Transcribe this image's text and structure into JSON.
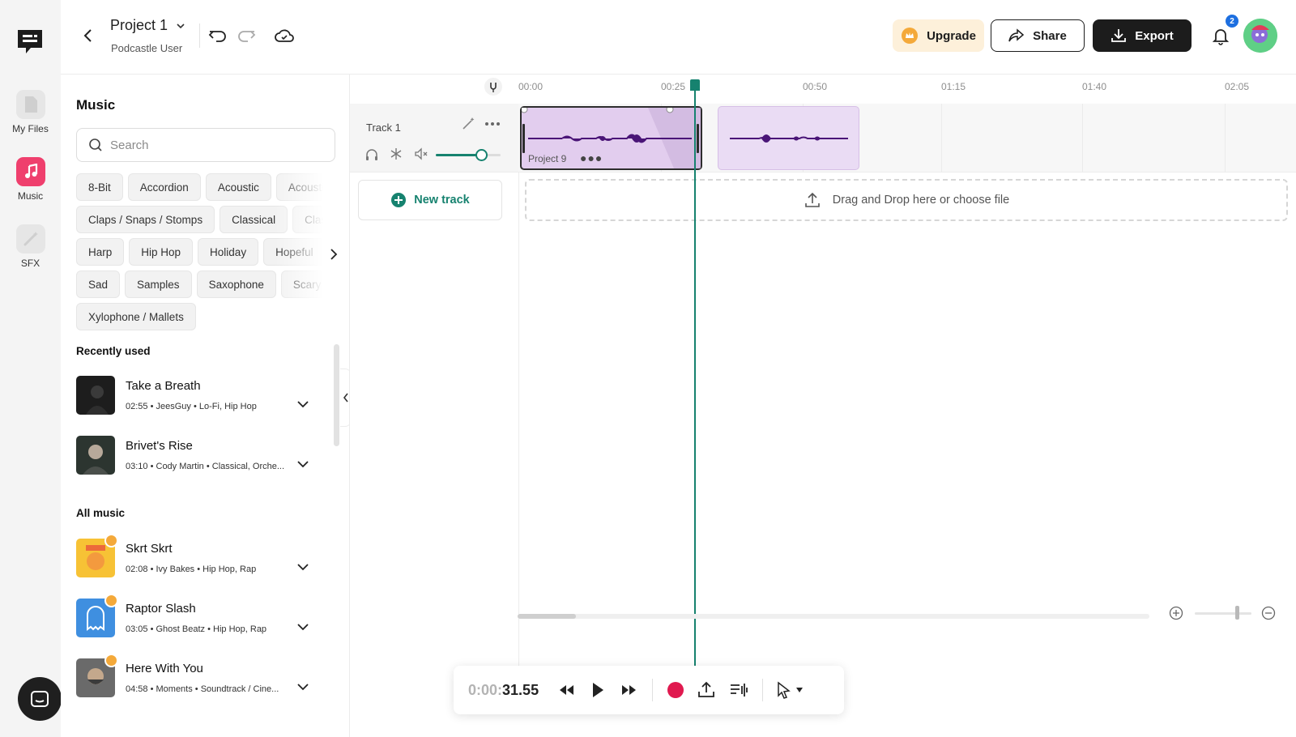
{
  "rail": {
    "items": [
      {
        "label": "My Files",
        "icon": "file-icon"
      },
      {
        "label": "Music",
        "icon": "music-note-icon"
      },
      {
        "label": "SFX",
        "icon": "magic-wand-icon"
      }
    ]
  },
  "header": {
    "project_title": "Project 1",
    "project_subtitle": "Podcastle User",
    "upgrade_label": "Upgrade",
    "share_label": "Share",
    "export_label": "Export",
    "notification_count": "2"
  },
  "panel": {
    "title": "Music",
    "search_placeholder": "Search",
    "tag_rows": [
      [
        "8-Bit",
        "Accordion",
        "Acoustic",
        "Acoustic"
      ],
      [
        "Claps / Snaps / Stomps",
        "Classical",
        "Classical"
      ],
      [
        "Harp",
        "Hip Hop",
        "Holiday",
        "Hopeful"
      ],
      [
        "Sad",
        "Samples",
        "Saxophone",
        "Scary"
      ],
      [
        "Xylophone / Mallets"
      ]
    ],
    "recently_used_label": "Recently used",
    "all_music_label": "All music",
    "recently_used": [
      {
        "title": "Take a Breath",
        "duration": "02:55",
        "artist": "JeesGuy",
        "genre": "Lo-Fi, Hip Hop"
      },
      {
        "title": "Brivet's Rise",
        "duration": "03:10",
        "artist": "Cody Martin",
        "genre": "Classical, Orche..."
      }
    ],
    "all_music": [
      {
        "title": "Skrt Skrt",
        "duration": "02:08",
        "artist": "Ivy Bakes",
        "genre": "Hip Hop, Rap",
        "premium": true
      },
      {
        "title": "Raptor Slash",
        "duration": "03:05",
        "artist": "Ghost Beatz",
        "genre": "Hip Hop, Rap",
        "premium": true
      },
      {
        "title": "Here With You",
        "duration": "04:58",
        "artist": "Moments",
        "genre": "Soundtrack / Cine...",
        "premium": true
      }
    ]
  },
  "timeline": {
    "ruler_labels": [
      "00:00",
      "00:25",
      "00:50",
      "01:15",
      "01:40",
      "02:05"
    ],
    "track_name": "Track 1",
    "clip_label": "Project 9",
    "new_track_label": "New track",
    "dropzone_label": "Drag and Drop here or choose file",
    "volume_level": 0.7,
    "playhead_time": "00:31.55"
  },
  "transport": {
    "time_dim": "0:00:",
    "time_main": "31.55"
  },
  "colors": {
    "accent": "#16826f",
    "record": "#e0194f",
    "clip": "#e2cdee",
    "waveform": "#4a1577"
  }
}
